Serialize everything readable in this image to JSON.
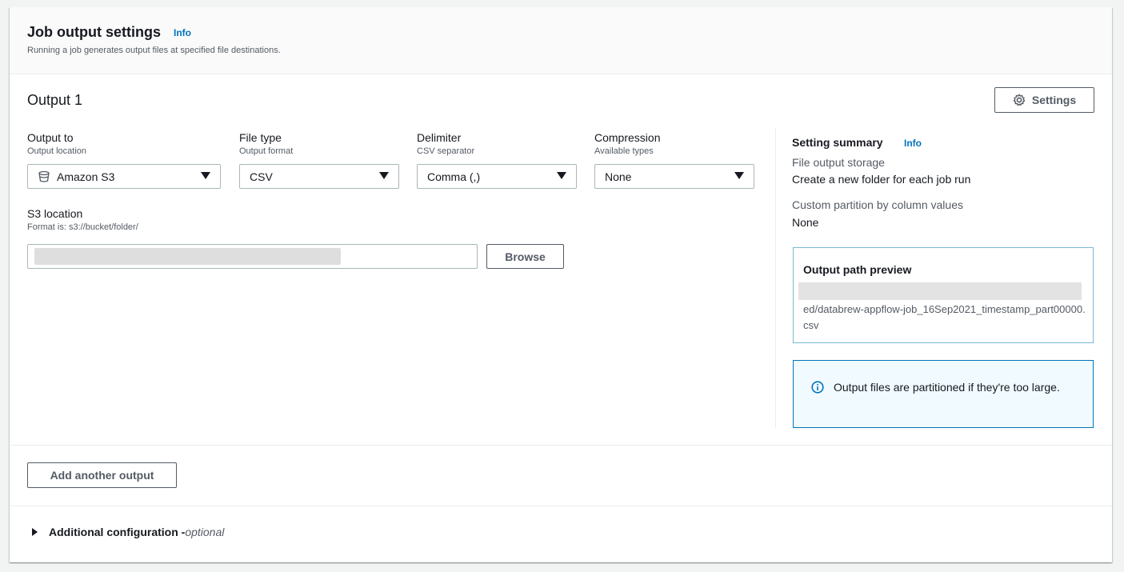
{
  "header": {
    "title": "Job output settings",
    "info": "Info",
    "description": "Running a job generates output files at specified file destinations."
  },
  "output": {
    "title": "Output 1",
    "settings_button": "Settings",
    "output_to": {
      "label": "Output to",
      "desc": "Output location",
      "value": "Amazon S3",
      "icon": "bucket-icon"
    },
    "file_type": {
      "label": "File type",
      "desc": "Output format",
      "value": "CSV"
    },
    "delimiter": {
      "label": "Delimiter",
      "desc": "CSV separator",
      "value": "Comma (,)"
    },
    "compression": {
      "label": "Compression",
      "desc": "Available types",
      "value": "None"
    },
    "s3_location": {
      "label": "S3 location",
      "desc": "Format is: s3://bucket/folder/",
      "value": ""
    },
    "browse_button": "Browse"
  },
  "summary": {
    "title": "Setting summary",
    "info": "Info",
    "file_output_storage_key": "File output storage",
    "file_output_storage_val": "Create a new folder for each job run",
    "custom_partition_key": "Custom partition by column values",
    "custom_partition_val": "None",
    "preview_title": "Output path preview",
    "preview_path": "ed/databrew-appflow-job_16Sep2021_timestamp_part00000.csv",
    "alert_text": "Output files are partitioned if they're too large."
  },
  "footer": {
    "add_output_button": "Add another output",
    "additional_config": "Additional configuration - ",
    "optional": "optional"
  },
  "colors": {
    "link": "#0073bb",
    "alert_bg": "#f1faff",
    "border": "#aab7b8"
  }
}
